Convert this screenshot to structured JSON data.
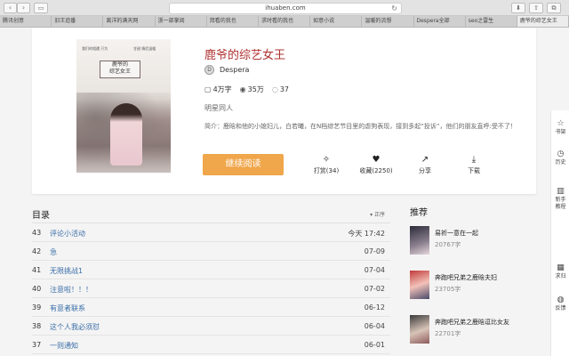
{
  "browser": {
    "url": "ihuaben.com",
    "tabs": [
      "腾讯创意",
      "旧王追番",
      "离洋的满天网",
      "浙一部掌阅",
      "拜看的我也",
      "求时看的我也",
      "如意小说",
      "温暖的流想",
      "Despera全部",
      "seo之雷生",
      "鹿爷的综艺女王"
    ]
  },
  "book": {
    "title": "鹿爷的综艺女王",
    "author": "Despera",
    "author_avatar": "D",
    "word_count": "4万字",
    "views": "35万",
    "comments": "37",
    "tag": "明星同人",
    "intro": "简介：鹿晗和他的小媳妇儿，白若曦，在N档综艺节目里的虐狗表现，接到多起“投诉”，他们的朋友直呼:受不了！",
    "cover": {
      "title_line1": "鹿爷的",
      "title_line2": "综艺女王",
      "note_left": "我们的相遇 只为",
      "note_right": "甘甜 情侣温暖"
    }
  },
  "actions": {
    "read_label": "继续阅读",
    "reward_label": "打赏(34)",
    "favorite_label": "收藏(2250)",
    "share_label": "分享",
    "download_label": "下载"
  },
  "toc": {
    "title": "目录",
    "sort_label": "正序",
    "chapters": [
      {
        "num": "43",
        "title": "评论小活动",
        "date": "今天 17:42"
      },
      {
        "num": "42",
        "title": "急",
        "date": "07-09"
      },
      {
        "num": "41",
        "title": "无限挑战1",
        "date": "07-04"
      },
      {
        "num": "40",
        "title": "注意啦！！！",
        "date": "07-02"
      },
      {
        "num": "39",
        "title": "有意者联系",
        "date": "06-12"
      },
      {
        "num": "38",
        "title": "这个人我必须怼",
        "date": "06-04"
      },
      {
        "num": "37",
        "title": "一则通知",
        "date": "06-01"
      }
    ]
  },
  "recommend": {
    "title": "推荐",
    "items": [
      {
        "name": "易祈一意在一起",
        "count": "20767字"
      },
      {
        "name": "奔跑吧兄弟之鹿晗夫妇",
        "count": "23705字"
      },
      {
        "name": "奔跑吧兄弟之鹿晗逗比女友",
        "count": "22701字"
      }
    ]
  },
  "sidebar": {
    "items": [
      {
        "label": "书架"
      },
      {
        "label": "历史"
      },
      {
        "label": "新手教程"
      },
      {
        "label": "求归"
      },
      {
        "label": "反馈"
      }
    ]
  },
  "colors": {
    "accent": "#f0a64a",
    "title": "#b03030",
    "link": "#3a6ea8"
  }
}
